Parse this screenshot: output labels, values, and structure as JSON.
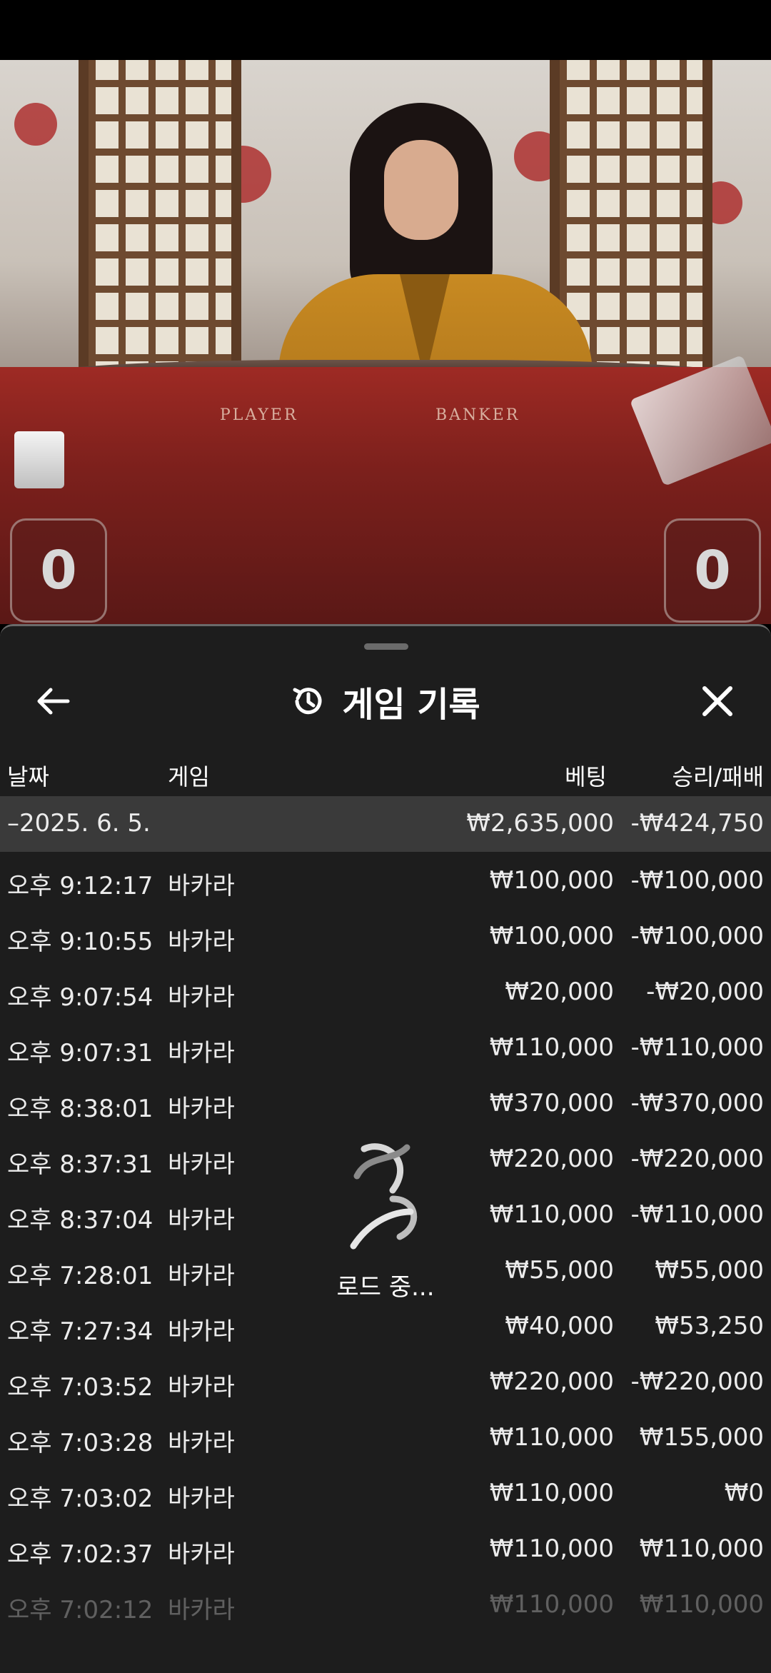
{
  "video": {
    "table_labels": {
      "player": "PLAYER",
      "banker": "BANKER"
    },
    "scores": {
      "player": "0",
      "banker": "0"
    }
  },
  "sheet": {
    "title": "게임 기록",
    "icons": {
      "back": "arrow-left-icon",
      "history": "history-icon",
      "close": "close-icon",
      "loader": "spinner-icon"
    },
    "columns": {
      "date": "날짜",
      "game": "게임",
      "bet": "베팅",
      "result": "승리/패배"
    },
    "date_group": {
      "label": "–2025. 6. 5.",
      "bet": "₩2,635,000",
      "result": "-₩424,750"
    },
    "rows": [
      {
        "time": "오후 9:12:17",
        "game": "바카라",
        "bet": "₩100,000",
        "result": "-₩100,000"
      },
      {
        "time": "오후 9:10:55",
        "game": "바카라",
        "bet": "₩100,000",
        "result": "-₩100,000"
      },
      {
        "time": "오후 9:07:54",
        "game": "바카라",
        "bet": "₩20,000",
        "result": "-₩20,000"
      },
      {
        "time": "오후 9:07:31",
        "game": "바카라",
        "bet": "₩110,000",
        "result": "-₩110,000"
      },
      {
        "time": "오후 8:38:01",
        "game": "바카라",
        "bet": "₩370,000",
        "result": "-₩370,000"
      },
      {
        "time": "오후 8:37:31",
        "game": "바카라",
        "bet": "₩220,000",
        "result": "-₩220,000"
      },
      {
        "time": "오후 8:37:04",
        "game": "바카라",
        "bet": "₩110,000",
        "result": "-₩110,000"
      },
      {
        "time": "오후 7:28:01",
        "game": "바카라",
        "bet": "₩55,000",
        "result": "₩55,000"
      },
      {
        "time": "오후 7:27:34",
        "game": "바카라",
        "bet": "₩40,000",
        "result": "₩53,250"
      },
      {
        "time": "오후 7:03:52",
        "game": "바카라",
        "bet": "₩220,000",
        "result": "-₩220,000"
      },
      {
        "time": "오후 7:03:28",
        "game": "바카라",
        "bet": "₩110,000",
        "result": "₩155,000"
      },
      {
        "time": "오후 7:03:02",
        "game": "바카라",
        "bet": "₩110,000",
        "result": "₩0"
      },
      {
        "time": "오후 7:02:37",
        "game": "바카라",
        "bet": "₩110,000",
        "result": "₩110,000"
      },
      {
        "time": "오후 7:02:12",
        "game": "바카라",
        "bet": "₩110,000",
        "result": "₩110,000"
      }
    ],
    "loading_text": "로드 중..."
  }
}
